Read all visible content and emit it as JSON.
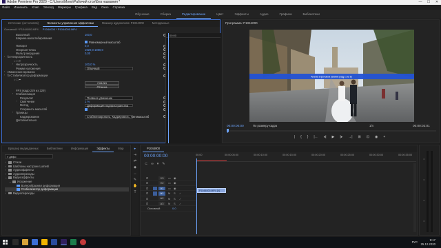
{
  "titlebar": {
    "title": "Adobe Premiere Pro 2020 - C:\\Users\\Монo\\Рабочий стол\\Без названия *",
    "controls": [
      "—",
      "☐",
      "✕"
    ]
  },
  "menubar": [
    "Файл",
    "Изменить",
    "Клип",
    "Эпизод",
    "Маркеры",
    "Графика",
    "Вид",
    "Окно",
    "Справка"
  ],
  "workspaces": [
    "Обучение",
    "Сборка",
    "Редактирование",
    "Цвет",
    "Эффекты",
    "Аудио",
    "Графика",
    "Библиотеки"
  ],
  "workspace_active": "Редактирование",
  "effect_controls": {
    "tabs": [
      "Источник: (нет клипов)",
      "Элементы управления эффектами",
      "Микшер аудиоклипа: P1044000",
      "Метаданные"
    ],
    "source_left": "Основной * P1044000.MP4",
    "source_right": "P1044000 * P1044000.MP4",
    "ruler_time": "00:00",
    "rows": [
      {
        "indent": 4,
        "chev": "",
        "label": "Высотный",
        "val": "100,0",
        "icon": true
      },
      {
        "indent": 4,
        "chev": "",
        "label": "Ширина масштабирования",
        "val": "",
        "icon": false
      },
      {
        "indent": 4,
        "chev": "",
        "label": "",
        "val": "Равномерный масштаб",
        "check": true,
        "icon": false
      },
      {
        "indent": 4,
        "chev": "",
        "label": "Поворот",
        "val": "0,0",
        "icon": true
      },
      {
        "indent": 4,
        "chev": "",
        "label": "Опорная точка",
        "val": "1920,0   1080,0",
        "icon": true
      },
      {
        "indent": 4,
        "chev": "",
        "label": "Фильтр мерцания",
        "val": "0,00",
        "icon": true
      },
      {
        "indent": 0,
        "chev": "›",
        "label": "fx Непрозрачность",
        "val": "",
        "icon": true
      },
      {
        "indent": 3,
        "chev": "",
        "label": "○ □ ✒",
        "val": "",
        "icon": false
      },
      {
        "indent": 4,
        "chev": "›",
        "label": "Непрозрачность",
        "val": "100,0 %",
        "icon": true
      },
      {
        "indent": 4,
        "chev": "",
        "label": "Режим наложения",
        "val": "Обычный",
        "dropdown": true,
        "icon": true
      },
      {
        "indent": 0,
        "chev": "›",
        "label": "Изменение времени",
        "val": "",
        "icon": false
      },
      {
        "indent": 0,
        "chev": "›",
        "label": "fx Стабилизатор деформации",
        "val": "",
        "icon": true
      },
      {
        "indent": 3,
        "chev": "",
        "label": "○ □ ✒",
        "val": "",
        "icon": false
      },
      {
        "indent": 4,
        "chev": "",
        "label": "",
        "val": "Анализ",
        "button": true,
        "icon": false
      },
      {
        "indent": 4,
        "chev": "",
        "label": "",
        "val": "Отмена",
        "button": true,
        "icon": false
      },
      {
        "indent": 4,
        "chev": "",
        "label": "FPS (кадр 229 из 229)",
        "val": "",
        "icon": false
      },
      {
        "indent": 4,
        "chev": "›",
        "label": "Стабилизация",
        "val": "",
        "icon": false
      },
      {
        "indent": 6,
        "chev": "",
        "label": "Результат",
        "val": "Плавное движение",
        "dropdown": true,
        "icon": true
      },
      {
        "indent": 6,
        "chev": "›",
        "label": "Смягчение",
        "val": "1 %",
        "icon": true
      },
      {
        "indent": 6,
        "chev": "",
        "label": "Метод",
        "val": "Деформация подпространства",
        "dropdown": true,
        "icon": true
      },
      {
        "indent": 6,
        "chev": "",
        "label": "Сохранить масштаб",
        "val": "",
        "check": true,
        "icon": true
      },
      {
        "indent": 4,
        "chev": "›",
        "label": "Границы",
        "val": "",
        "icon": false
      },
      {
        "indent": 6,
        "chev": "",
        "label": "Кадрирование",
        "val": "Стабилизировать, Кадрировать, Автомасштаб",
        "dropdown": true,
        "icon": true
      },
      {
        "indent": 4,
        "chev": "",
        "label": "Дополнительно",
        "val": "",
        "icon": false
      }
    ]
  },
  "program": {
    "title": "Программа: P1044000",
    "overlay_text": "Анализ в фоновом режиме (кадр 1 из 8)",
    "timecode_left": "00:00:00:00",
    "fit": "По размеру кадра",
    "quality": "1/4",
    "timecode_right": "00:00:02:01",
    "transport": [
      "|",
      "{",
      "}",
      "|←",
      "◂|",
      "▶",
      "|▸",
      "→|",
      "⊞",
      "⊡",
      "◉",
      "+"
    ]
  },
  "effects_panel": {
    "tabs": [
      "Браузер медиаданных",
      "Библиотеки",
      "Информация",
      "Эффекты",
      "Мар"
    ],
    "search": "дефо",
    "tree": [
      {
        "indent": 0,
        "label": "Стили",
        "type": "folder",
        "chev": "›"
      },
      {
        "indent": 0,
        "label": "Шаблоны настроек Lumetri",
        "type": "folder",
        "chev": "›"
      },
      {
        "indent": 0,
        "label": "Аудиоэффекты",
        "type": "folder",
        "chev": "›"
      },
      {
        "indent": 0,
        "label": "Аудиопереходы",
        "type": "folder",
        "chev": "›"
      },
      {
        "indent": 0,
        "label": "Видеоэффекты",
        "type": "folder",
        "chev": "⌄"
      },
      {
        "indent": 1,
        "label": "Искажение",
        "type": "folder",
        "chev": "⌄"
      },
      {
        "indent": 2,
        "label": "Волнообразная деформация",
        "type": "fx",
        "chev": ""
      },
      {
        "indent": 2,
        "label": "Стабилизатор деформации",
        "type": "fx",
        "chev": "",
        "selected": true
      },
      {
        "indent": 0,
        "label": "Видеопереходы",
        "type": "folder",
        "chev": "›"
      }
    ]
  },
  "tools": [
    "▸",
    "⇥",
    "⇄",
    "◆",
    "↔",
    "✎",
    "✋",
    "T"
  ],
  "timeline": {
    "tab": "P1044000",
    "timecode": "00:00:00:00",
    "ruler": [
      "00:00",
      "00:00:05:00",
      "00:00:10:00",
      "00:00:15:00",
      "00:00:20:00",
      "00:00:25:00",
      "00:00:30:00",
      "00:00:35:00"
    ],
    "video_tracks": [
      "V3",
      "V2",
      "V1"
    ],
    "audio_tracks": [
      "A1",
      "A2",
      "A3"
    ],
    "master": "Основной",
    "master_val": "0,0",
    "clip_label": "P1044000.MP4 [V]"
  },
  "taskbar": {
    "lang": "РУС",
    "time": "9:17",
    "date": "25.12.2020"
  },
  "colors": {
    "accent": "#6ea6ff",
    "panel": "#232323",
    "bg": "#1d1d1d",
    "overlay": "#2352d4"
  }
}
